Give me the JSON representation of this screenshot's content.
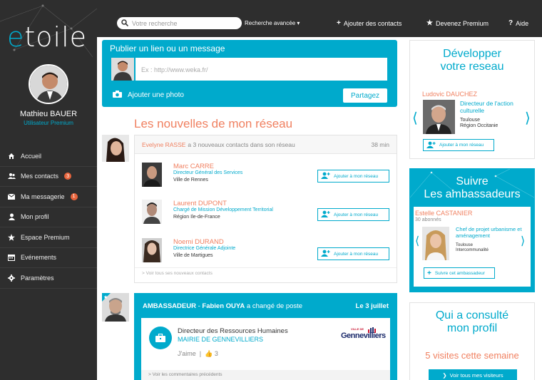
{
  "app": {
    "logo": "etoile"
  },
  "user": {
    "name": "Mathieu BAUER",
    "role": "Utilisateur Premium"
  },
  "nav": [
    {
      "label": "Accueil",
      "icon": "home-icon"
    },
    {
      "label": "Mes contacts",
      "icon": "contacts-icon",
      "badge": "3"
    },
    {
      "label": "Ma messagerie",
      "icon": "mail-icon",
      "badge": "1"
    },
    {
      "label": "Mon profil",
      "icon": "user-icon"
    },
    {
      "label": "Espace Premium",
      "icon": "star-icon"
    },
    {
      "label": "Evénements",
      "icon": "calendar-icon"
    },
    {
      "label": "Paramètres",
      "icon": "gear-icon"
    }
  ],
  "topbar": {
    "search_placeholder": "Votre recherche",
    "advanced": "Recherche avancée",
    "add_contacts": "Ajouter des contacts",
    "premium": "Devenez Premium",
    "help": "Aide"
  },
  "publish": {
    "title": "Publier un lien ou un message",
    "placeholder": "Ex : http://www.weka.fr/",
    "add_photo": "Ajouter une photo",
    "share": "Partagez"
  },
  "network": {
    "title": "Les nouvelles de mon réseau",
    "feed1": {
      "actor": "Evelyne RASSE",
      "action": "a 3 nouveaux contacts dans son réseau",
      "time": "38 min",
      "contacts": [
        {
          "name": "Marc CARRE",
          "title": "Directeur Général des Services",
          "location": "Ville de Rennes"
        },
        {
          "name": "Laurent DUPONT",
          "title": "Chargé de Mission Développement Territorial",
          "location": "Région Ile-de-France"
        },
        {
          "name": "Noemi DURAND",
          "title": "Directrice Générale Adjointe",
          "location": "Ville de Martigues"
        }
      ],
      "add_label": "Ajouter à mon réseau",
      "see_all": "> Voir tous ses nouveaux contacts"
    },
    "feed2": {
      "prefix": "AMBASSADEUR",
      "actor": "Fabien OUYA",
      "action": "a changé de poste",
      "date": "Le 3 juillet",
      "job_title": "Directeur des Ressources Humaines",
      "company": "MAIRIE DE GENNEVILLIERS",
      "like_label": "J'aime",
      "like_count": "3",
      "logo_small": "VILLE DE",
      "logo_text": "Gennevilliers",
      "more": "> Voir les commentaires précédents"
    }
  },
  "develop": {
    "title_line1": "Développer",
    "title_line2": "votre reseau",
    "name": "Ludovic DAUCHEZ",
    "title": "Directeur de l'action culturelle",
    "loc1": "Toulouse",
    "loc2": "Région Occitanie",
    "add_label": "Ajouter à mon réseau"
  },
  "ambassadors": {
    "title_line1": "Suivre",
    "title_line2": "Les ambassadeurs",
    "name": "Estelle CASTANIER",
    "followers": "30 abonnés",
    "title": "Chef de projet urbanisme et aménagement",
    "loc1": "Toulouse",
    "loc2": "Intercommunalité",
    "follow_label": "Suivre cet ambassadeur"
  },
  "visitors": {
    "title_line1": "Qui a consulté",
    "title_line2": "mon profil",
    "count_text": "5 visites cette semaine",
    "button": "Voir tous mes visiteurs"
  },
  "colors": {
    "accent": "#00aacc",
    "highlight": "#f08060",
    "dark": "#2e2e2e",
    "badge": "#e8643c"
  }
}
